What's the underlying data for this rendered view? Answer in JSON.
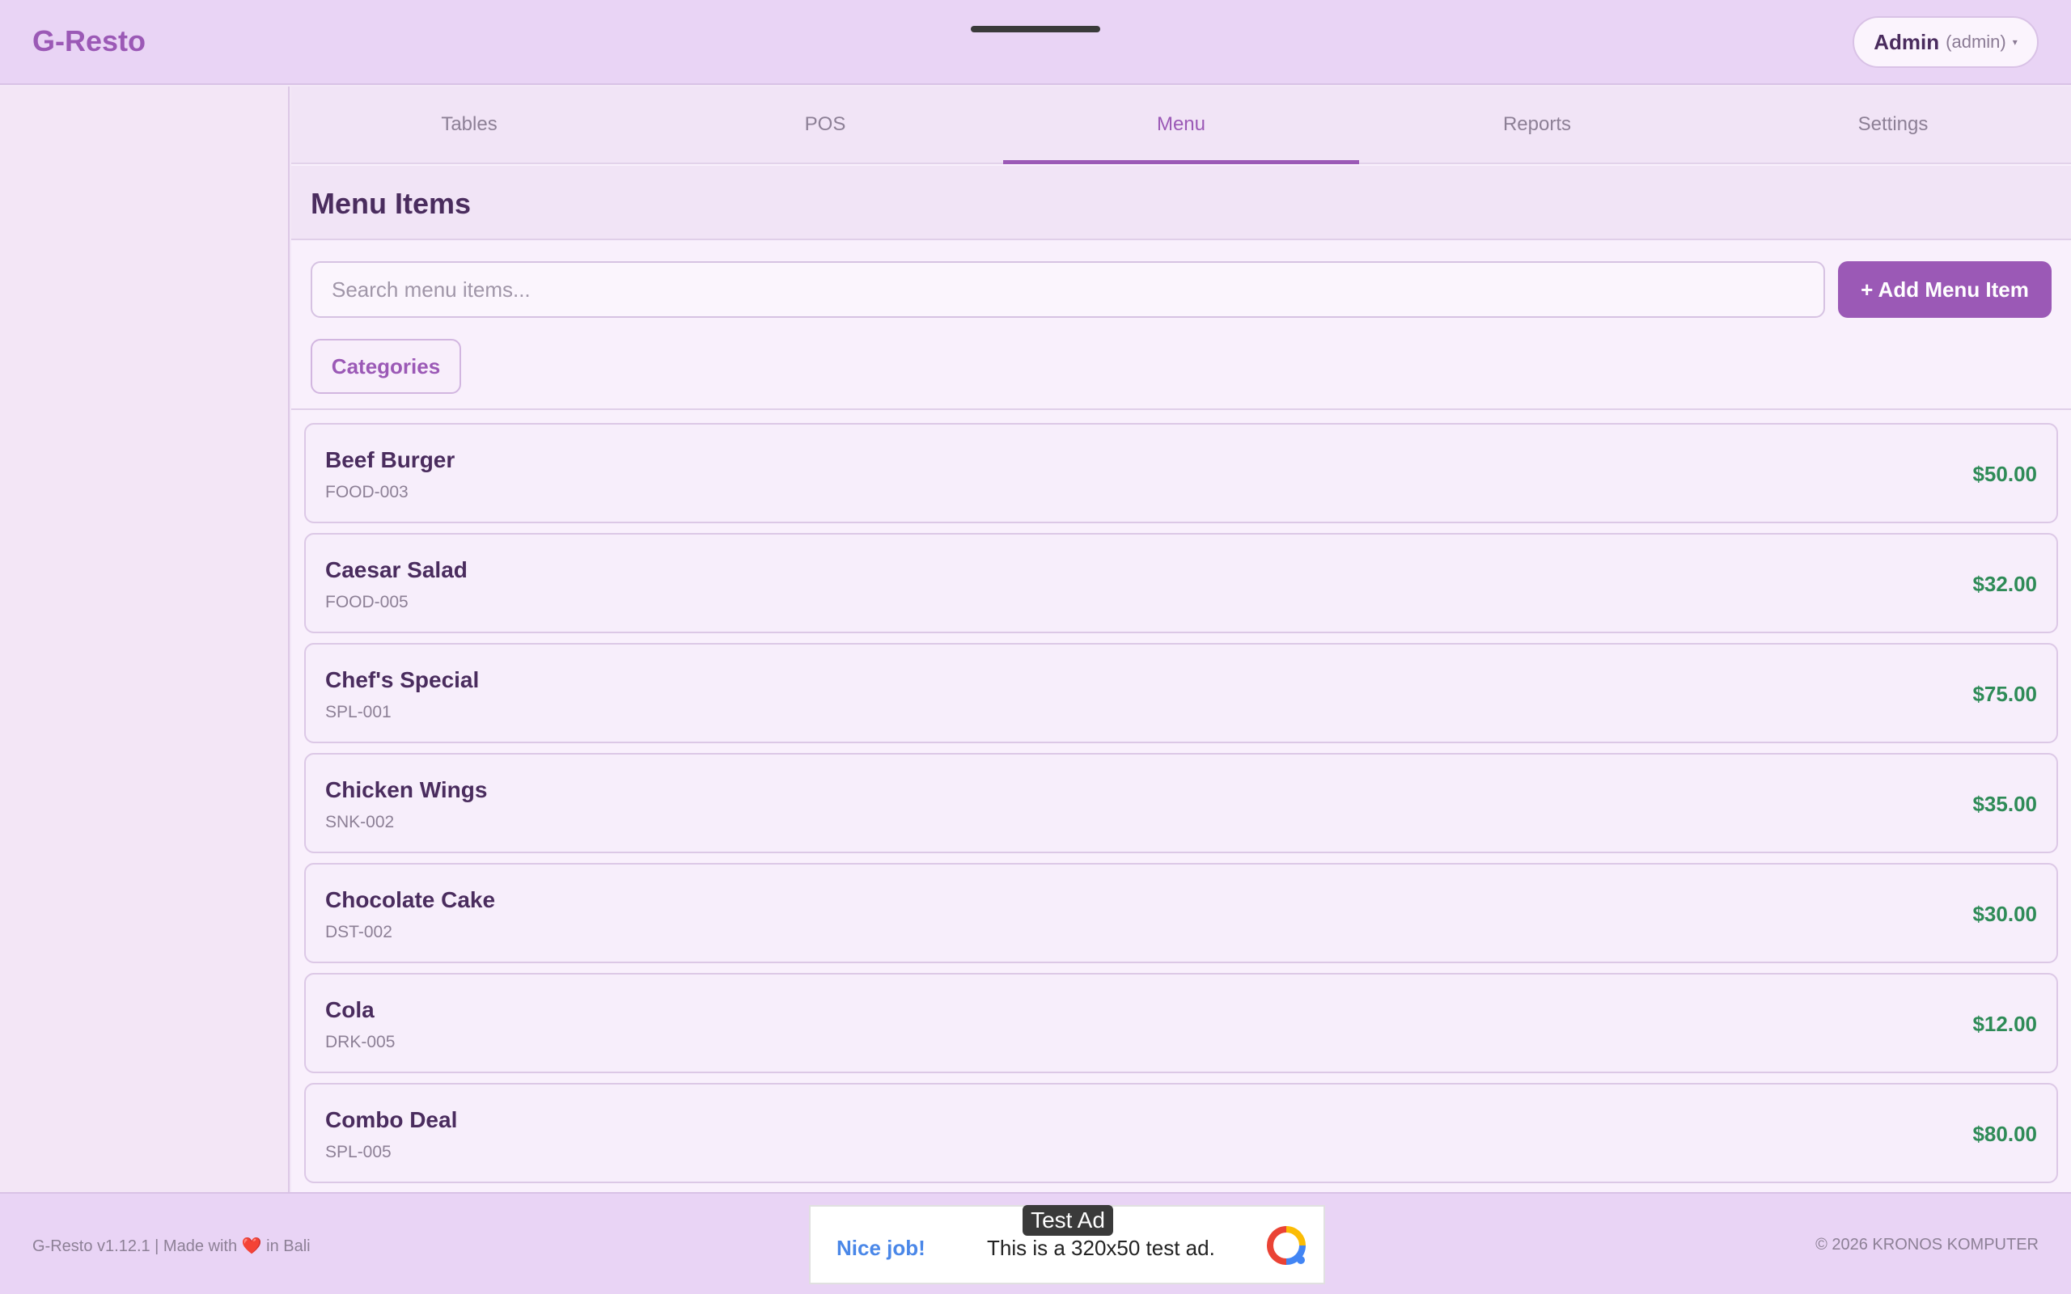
{
  "app": {
    "brand": "G-Resto"
  },
  "user": {
    "name": "Admin",
    "role": "(admin)",
    "caret": "▾"
  },
  "tabs": [
    {
      "label": "Tables",
      "active": false
    },
    {
      "label": "POS",
      "active": false
    },
    {
      "label": "Menu",
      "active": true
    },
    {
      "label": "Reports",
      "active": false
    },
    {
      "label": "Settings",
      "active": false
    }
  ],
  "page": {
    "title": "Menu Items",
    "search_placeholder": "Search menu items...",
    "search_value": "",
    "add_button": "+ Add Menu Item",
    "categories_button": "Categories"
  },
  "menu_items": [
    {
      "name": "Beef Burger",
      "code": "FOOD-003",
      "price": "$50.00"
    },
    {
      "name": "Caesar Salad",
      "code": "FOOD-005",
      "price": "$32.00"
    },
    {
      "name": "Chef's Special",
      "code": "SPL-001",
      "price": "$75.00"
    },
    {
      "name": "Chicken Wings",
      "code": "SNK-002",
      "price": "$35.00"
    },
    {
      "name": "Chocolate Cake",
      "code": "DST-002",
      "price": "$30.00"
    },
    {
      "name": "Cola",
      "code": "DRK-005",
      "price": "$12.00"
    },
    {
      "name": "Combo Deal",
      "code": "SPL-005",
      "price": "$80.00"
    }
  ],
  "footer": {
    "version": "G-Resto v1.12.1 | Made with",
    "heart": "❤️",
    "location": "in Bali",
    "copyright": "© 2026 KRONOS KOMPUTER"
  },
  "ad": {
    "tag": "Test Ad",
    "headline": "Nice job!",
    "text": "This is a 320x50 test ad."
  },
  "colors": {
    "accent": "#9b59b6",
    "price": "#2e8b57",
    "header_bg": "#e9d4f5"
  }
}
